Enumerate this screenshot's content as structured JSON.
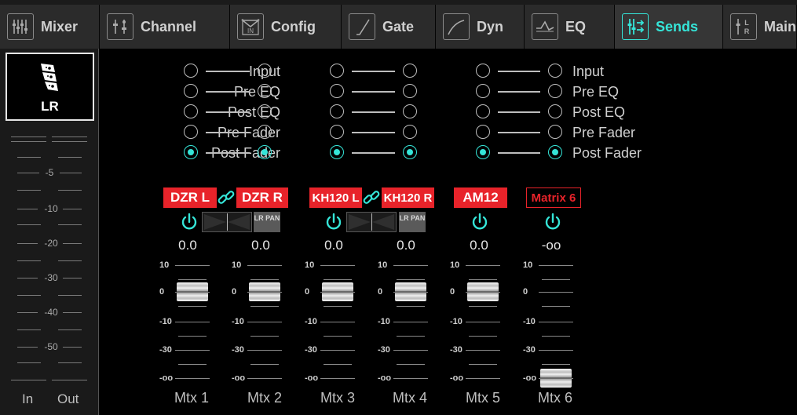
{
  "tabs": [
    {
      "label": "Mixer",
      "icon": "mixer-icon"
    },
    {
      "label": "Channel",
      "icon": "channel-icon"
    },
    {
      "label": "Config",
      "icon": "config-icon",
      "icon_text": "IN"
    },
    {
      "label": "Gate",
      "icon": "gate-curve-icon"
    },
    {
      "label": "Dyn",
      "icon": "dyn-curve-icon"
    },
    {
      "label": "EQ",
      "icon": "eq-curve-icon"
    },
    {
      "label": "Sends",
      "icon": "sends-icon",
      "active": true
    },
    {
      "label": "Main",
      "icon": "main-lr-icon",
      "icon_text": "L R"
    }
  ],
  "bus": {
    "label": "LR",
    "icon": "line-array-speaker-icon"
  },
  "meter": {
    "labels": [
      "-5",
      "-10",
      "-20",
      "-30",
      "-40",
      "-50"
    ],
    "in_label": "In",
    "out_label": "Out"
  },
  "tap_points": [
    "Input",
    "Pre EQ",
    "Post EQ",
    "Pre Fader",
    "Post Fader"
  ],
  "tap_selected": "Post Fader",
  "channels": [
    {
      "name": "DZR L",
      "linked": true,
      "value": "0.0",
      "mtx": "Mtx 1",
      "level": 0
    },
    {
      "name": "DZR R",
      "linked": true,
      "value": "0.0",
      "mtx": "Mtx 2",
      "level": 0,
      "pan_label": "LR PAN"
    },
    {
      "name": "KH120 L",
      "linked": true,
      "value": "0.0",
      "mtx": "Mtx 3",
      "level": 0
    },
    {
      "name": "KH120 R",
      "linked": true,
      "value": "0.0",
      "mtx": "Mtx 4",
      "level": 0,
      "pan_label": "LR PAN"
    },
    {
      "name": "AM12",
      "linked": false,
      "value": "0.0",
      "mtx": "Mtx 5",
      "level": 0
    },
    {
      "name": "Matrix 6",
      "linked": false,
      "value": "-oo",
      "mtx": "Mtx 6",
      "level": "-oo"
    }
  ],
  "fader_scale": [
    "10",
    "0",
    "-10",
    "-30",
    "-oo"
  ],
  "colors": {
    "accent": "#35e5d8",
    "name_red": "#e8232a",
    "background": "#000000",
    "panel": "#1a1a1a"
  }
}
